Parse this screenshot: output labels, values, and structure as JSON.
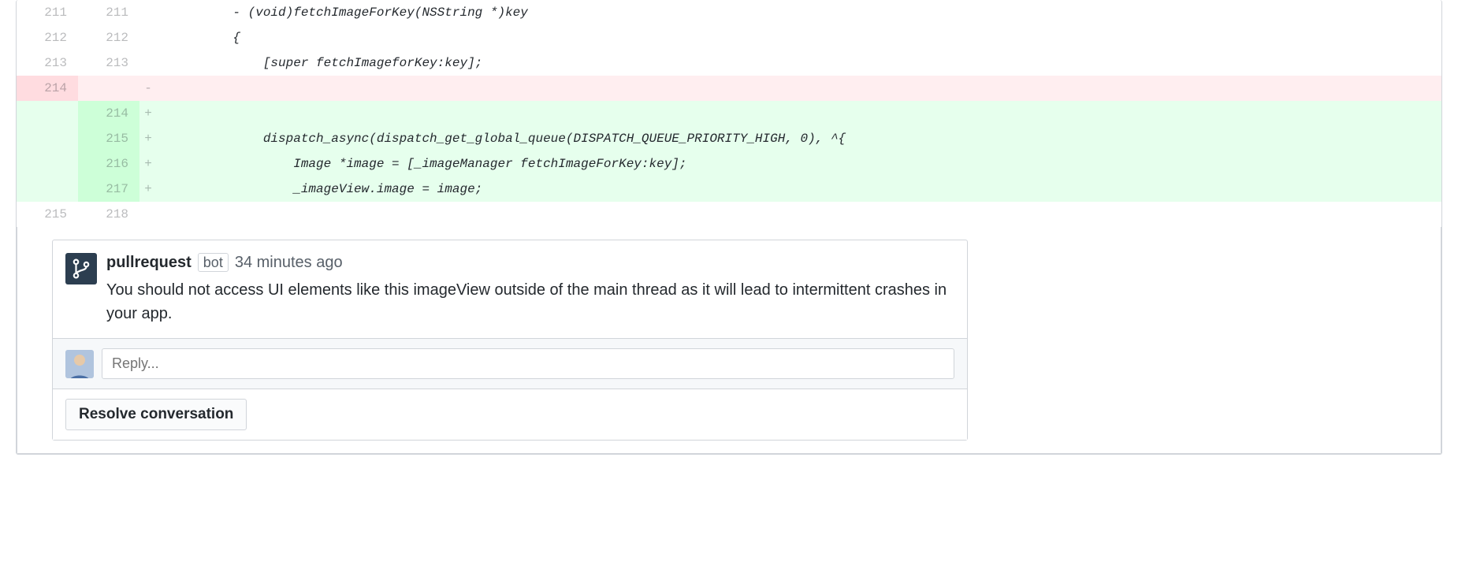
{
  "diff": {
    "rows": [
      {
        "old": "211",
        "new": "211",
        "marker": "",
        "class": "",
        "code": "         - (void)fetchImageForKey(NSString *)key"
      },
      {
        "old": "212",
        "new": "212",
        "marker": "",
        "class": "",
        "code": "         {"
      },
      {
        "old": "213",
        "new": "213",
        "marker": "",
        "class": "",
        "code": "             [super fetchImageforKey:key];"
      },
      {
        "old": "214",
        "new": "",
        "marker": "-",
        "class": "deletion",
        "code": ""
      },
      {
        "old": "",
        "new": "214",
        "marker": "+",
        "class": "addition",
        "code": ""
      },
      {
        "old": "",
        "new": "215",
        "marker": "+",
        "class": "addition",
        "code": "             dispatch_async(dispatch_get_global_queue(DISPATCH_QUEUE_PRIORITY_HIGH, 0), ^{"
      },
      {
        "old": "",
        "new": "216",
        "marker": "+",
        "class": "addition",
        "code": "                 Image *image = [_imageManager fetchImageForKey:key];"
      },
      {
        "old": "",
        "new": "217",
        "marker": "+",
        "class": "addition",
        "code": "                 _imageView.image = image;"
      },
      {
        "old": "215",
        "new": "218",
        "marker": "",
        "class": "",
        "code": ""
      }
    ]
  },
  "comment": {
    "author": "pullrequest",
    "badge": "bot",
    "timestamp": "34 minutes ago",
    "body": "You should not access UI elements like this imageView outside of the main thread as it will lead to intermittent crashes in your app."
  },
  "reply": {
    "placeholder": "Reply..."
  },
  "actions": {
    "resolve": "Resolve conversation"
  }
}
